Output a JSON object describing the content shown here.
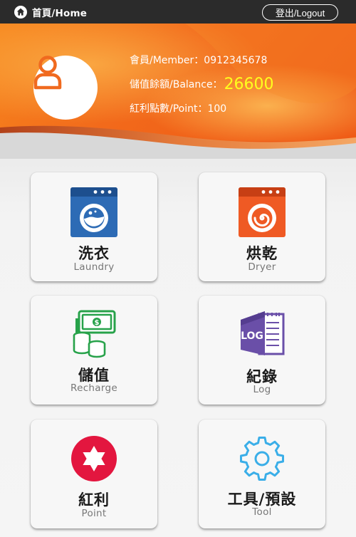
{
  "topbar": {
    "home_label": "首頁/Home",
    "logout_label": "登出/Logout"
  },
  "member": {
    "member_line": "會員/Member：0912345678",
    "balance_label": "儲值餘額/Balance：",
    "balance_value": "26600",
    "point_line": "紅利點數/Point：100"
  },
  "tiles": [
    {
      "title": "洗衣",
      "subtitle": "Laundry",
      "icon": "washing-machine-icon"
    },
    {
      "title": "烘乾",
      "subtitle": "Dryer",
      "icon": "dryer-icon"
    },
    {
      "title": "儲值",
      "subtitle": "Recharge",
      "icon": "money-coins-icon"
    },
    {
      "title": "紀錄",
      "subtitle": "Log",
      "icon": "log-book-icon"
    },
    {
      "title": "紅利",
      "subtitle": "Point",
      "icon": "star-badge-icon"
    },
    {
      "title": "工具/預設",
      "subtitle": "Tool",
      "icon": "gear-icon"
    }
  ],
  "colors": {
    "topbar": "#2b2b2b",
    "header_orange": "#f26a1b",
    "balance_highlight": "#ffff1e",
    "washer_blue": "#2d6bb5",
    "dryer_orange": "#ef5a24",
    "recharge_green": "#27a24a",
    "log_purple": "#6a4fa8",
    "point_red": "#e3163f",
    "tool_blue": "#3aaee8"
  }
}
